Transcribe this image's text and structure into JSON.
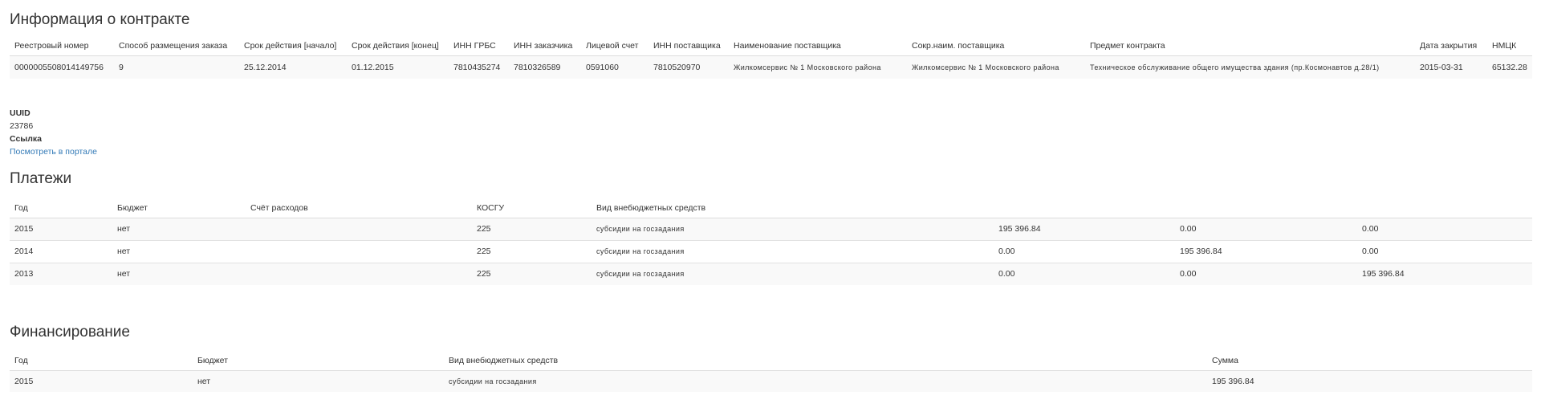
{
  "contract": {
    "title": "Информация о контракте",
    "headers": [
      "Реестровый номер",
      "Способ размещения заказа",
      "Срок действия [начало]",
      "Срок действия [конец]",
      "ИНН ГРБС",
      "ИНН заказчика",
      "Лицевой счет",
      "ИНН поставщика",
      "Наименование поставщика",
      "Сокр.наим. поставщика",
      "Предмет контракта",
      "Дата закрытия",
      "НМЦК"
    ],
    "row": [
      "0000005508014149756",
      "9",
      "25.12.2014",
      "01.12.2015",
      "7810435274",
      "7810326589",
      "0591060",
      "7810520970",
      "Жилкомсервис № 1 Московского района",
      "Жилкомсервис № 1 Московского района",
      "Техническое обслуживание общего имущества здания (пр.Космонавтов д.28/1)",
      "2015-03-31",
      "65132.28"
    ]
  },
  "info": {
    "uuid_label": "UUID",
    "uuid_value": "23786",
    "link_label": "Ссылка",
    "link_text": "Посмотреть в портале"
  },
  "payments": {
    "title": "Платежи",
    "headers": [
      "Год",
      "Бюджет",
      "Счёт расходов",
      "КОСГУ",
      "Вид внебюджетных средств",
      "",
      "",
      ""
    ],
    "rows": [
      [
        "2015",
        "нет",
        "",
        "225",
        "субсидии на госзадания",
        "195 396.84",
        "0.00",
        "0.00"
      ],
      [
        "2014",
        "нет",
        "",
        "225",
        "субсидии на госзадания",
        "0.00",
        "195 396.84",
        "0.00"
      ],
      [
        "2013",
        "нет",
        "",
        "225",
        "субсидии на госзадания",
        "0.00",
        "0.00",
        "195 396.84"
      ]
    ]
  },
  "financing": {
    "title": "Финансирование",
    "headers": [
      "Год",
      "Бюджет",
      "Вид внебюджетных средств",
      "Сумма"
    ],
    "rows": [
      [
        "2015",
        "нет",
        "субсидии на госзадания",
        "195 396.84"
      ]
    ]
  }
}
